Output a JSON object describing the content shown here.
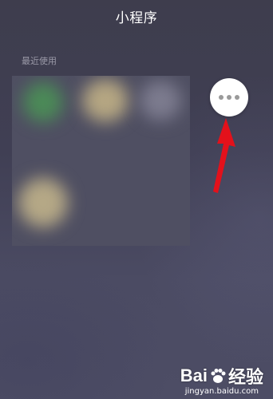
{
  "header": {
    "title": "小程序"
  },
  "recent": {
    "label": "最近使用"
  },
  "more_button": {
    "icon": "more-dots-icon"
  },
  "watermark": {
    "brand_a": "Bai",
    "brand_b": "经验",
    "domain": "jingyan.baidu.com"
  },
  "colors": {
    "background": "#403f54",
    "annotation_arrow": "#e3111b",
    "button": "#ffffff"
  }
}
